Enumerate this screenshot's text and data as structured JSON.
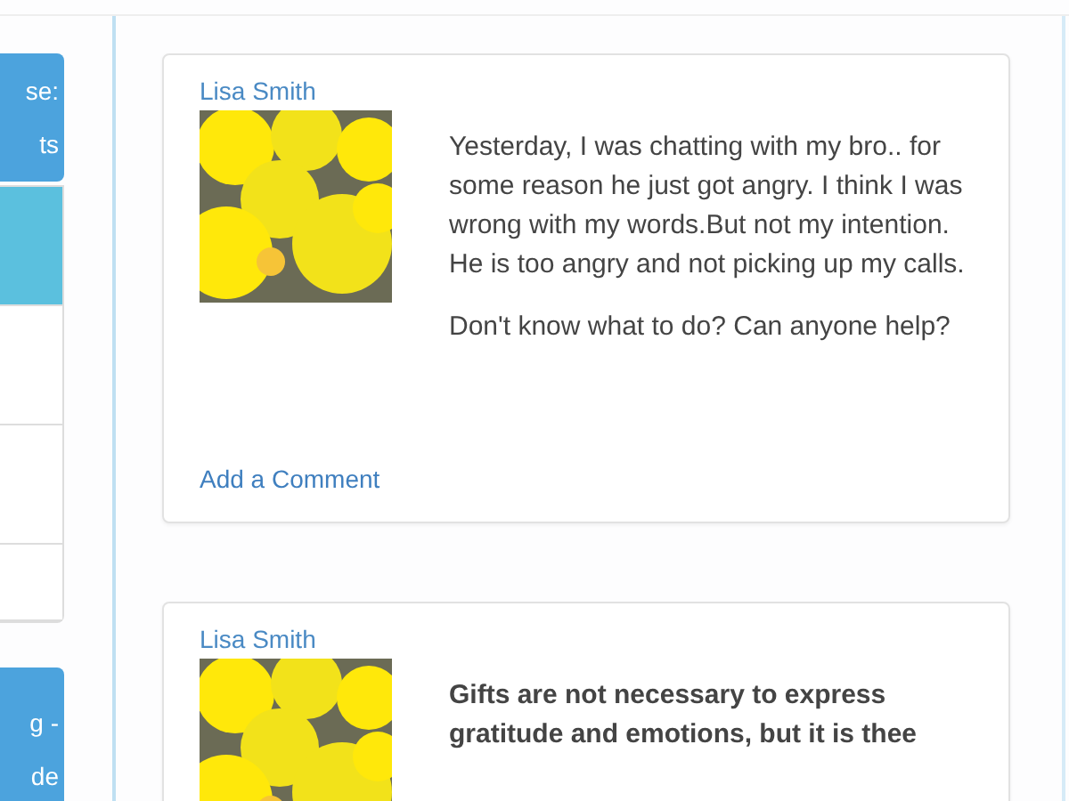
{
  "sidebar": {
    "cards": [
      {
        "lines": [
          "se:",
          "ts"
        ]
      },
      {
        "lines": [
          "g -",
          "de"
        ]
      }
    ],
    "list": [
      {
        "selected": true
      },
      {
        "selected": false
      },
      {
        "selected": false
      },
      {
        "selected": false
      }
    ]
  },
  "posts": [
    {
      "author": "Lisa Smith",
      "bold": false,
      "paragraphs": [
        "Yesterday, I was chatting with my bro.. for some reason he just got angry. I think I was wrong with my words.But not my intention. He is too angry and not picking up my calls.",
        "Don't know what to do? Can anyone help?"
      ],
      "action": "Add a Comment"
    },
    {
      "author": "Lisa Smith",
      "bold": true,
      "paragraphs": [
        "Gifts are not necessary to express gratitude and emotions, but it is thee"
      ]
    }
  ]
}
